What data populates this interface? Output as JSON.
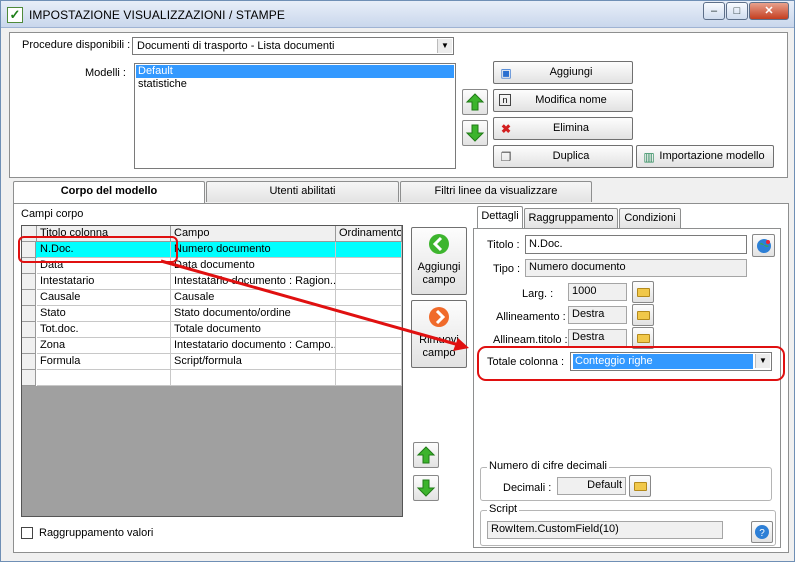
{
  "window": {
    "title": "IMPOSTAZIONE VISUALIZZAZIONI / STAMPE",
    "minimize": "–",
    "maximize": "□",
    "close": "✕"
  },
  "procedure": {
    "label": "Procedure disponibili :",
    "value": "Documenti di trasporto - Lista documenti"
  },
  "modelli": {
    "label": "Modelli :",
    "items": [
      "Default",
      "statistiche"
    ]
  },
  "buttons": {
    "aggiungi": "Aggiungi",
    "modifica_nome": "Modifica nome",
    "elimina": "Elimina",
    "duplica": "Duplica",
    "importazione": "Importazione modello"
  },
  "tabs": [
    "Corpo del modello",
    "Utenti abilitati",
    "Filtri linee da visualizzare"
  ],
  "campi_corpo": {
    "label": "Campi corpo",
    "columns": [
      "Titolo colonna",
      "Campo",
      "Ordinamento"
    ],
    "rows": [
      [
        "N.Doc.",
        "Numero documento",
        ""
      ],
      [
        "Data",
        "Data documento",
        ""
      ],
      [
        "Intestatario",
        "Intestatario documento : Ragion...",
        ""
      ],
      [
        "Causale",
        "Causale",
        ""
      ],
      [
        "Stato",
        "Stato documento/ordine",
        ""
      ],
      [
        "Tot.doc.",
        "Totale documento",
        ""
      ],
      [
        "Zona",
        "Intestatario documento : Campo...",
        ""
      ],
      [
        "Formula",
        "Script/formula",
        ""
      ]
    ]
  },
  "field_buttons": {
    "aggiungi_campo": "Aggiungi campo",
    "rimuovi_campo": "Rimuovi campo"
  },
  "detail_tabs": [
    "Dettagli",
    "Raggruppamento",
    "Condizioni"
  ],
  "dettagli": {
    "titolo_label": "Titolo :",
    "titolo_value": "N.Doc.",
    "tipo_label": "Tipo :",
    "tipo_value": "Numero documento",
    "larg_label": "Larg. :",
    "larg_value": "1000",
    "allineamento_label": "Allineamento :",
    "allineamento_value": "Destra",
    "allineam_titolo_label": "Allineam.titolo :",
    "allineam_titolo_value": "Destra",
    "totale_label": "Totale colonna :",
    "totale_value": "Conteggio righe",
    "decimali_group": "Numero di cifre decimali",
    "decimali_label": "Decimali :",
    "decimali_value": "Default",
    "script_group": "Script",
    "script_value": "RowItem.CustomField(10)"
  },
  "raggruppamento_valori": "Raggruppamento valori",
  "colors": {
    "selected_row": "#00ffff",
    "highlight": "#e01010",
    "list_selection": "#3399ff"
  }
}
